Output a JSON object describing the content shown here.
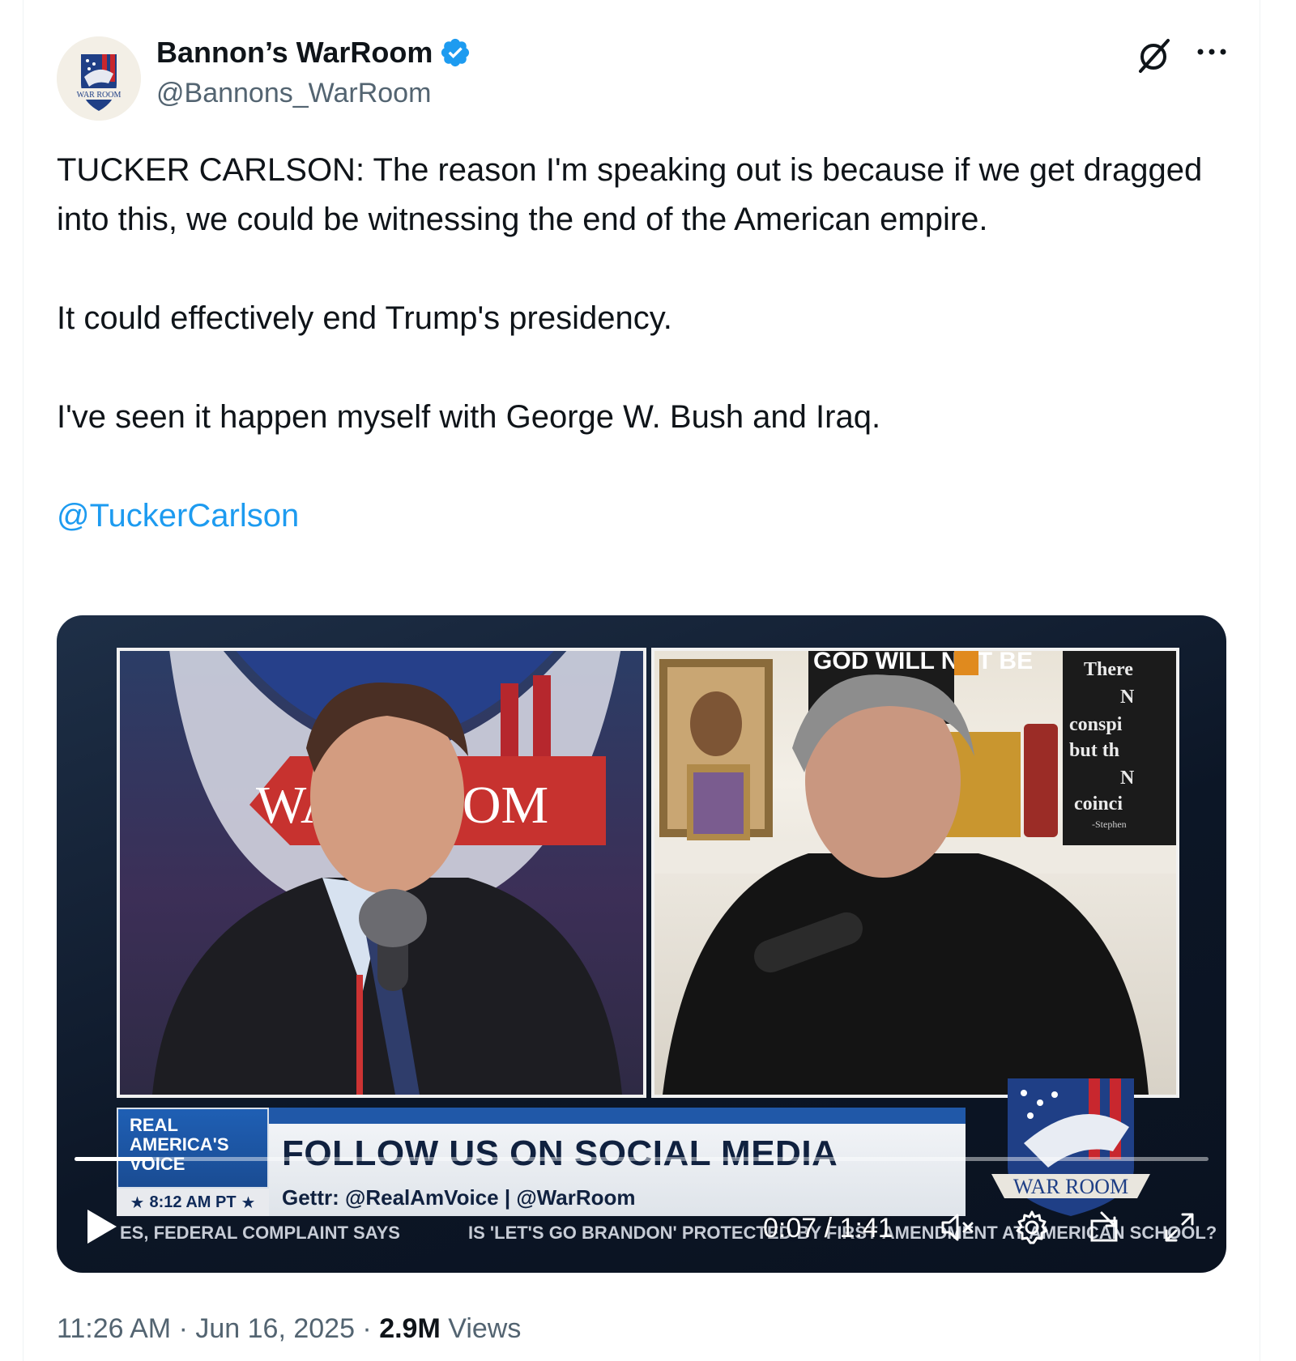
{
  "author": {
    "display_name": "Bannon’s WarRoom",
    "handle": "@Bannons_WarRoom",
    "avatar_text": "WAR ROOM",
    "verified": true
  },
  "tweet": {
    "paragraphs": [
      "TUCKER CARLSON: The reason I'm speaking out is because if we get dragged into this, we could be witnessing the end of the American empire.",
      "It could effectively end Trump's presidency.",
      "I've seen it happen myself with George W. Bush and Iraq."
    ],
    "mention": "@TuckerCarlson"
  },
  "video": {
    "left_backdrop_text": "WAR ROOM",
    "shelf_sign": "GOD WILL NOT BE",
    "quote_card": [
      "There",
      "N",
      "conspi",
      "but th",
      "N",
      "coinci",
      "-Stephen"
    ],
    "network_lines": [
      "REAL",
      "AMERICA'S",
      "VOICE"
    ],
    "broadcast_time": "8:12 AM PT",
    "headline": "FOLLOW US ON SOCIAL MEDIA",
    "subline": "Gettr: @RealAmVoice | @WarRoom",
    "logo_text": "WAR ROOM",
    "ticker_items": [
      "ES, FEDERAL COMPLAINT SAYS",
      "IS 'LET'S GO BRANDON' PROTECTED BY FIRST AMENDMENT AT AMERICAN SCHOOL?"
    ],
    "current_time": "0:07",
    "duration": "1:41",
    "time_separator": " / ",
    "progress_fraction": 0.069,
    "muted": true
  },
  "meta": {
    "time": "11:26 AM",
    "separator": " · ",
    "date": "Jun 16, 2025",
    "views_count": "2.9M",
    "views_label": "Views"
  },
  "colors": {
    "link": "#1d9bf0",
    "secondary_text": "#536471",
    "verified_badge": "#1d9bf0"
  }
}
